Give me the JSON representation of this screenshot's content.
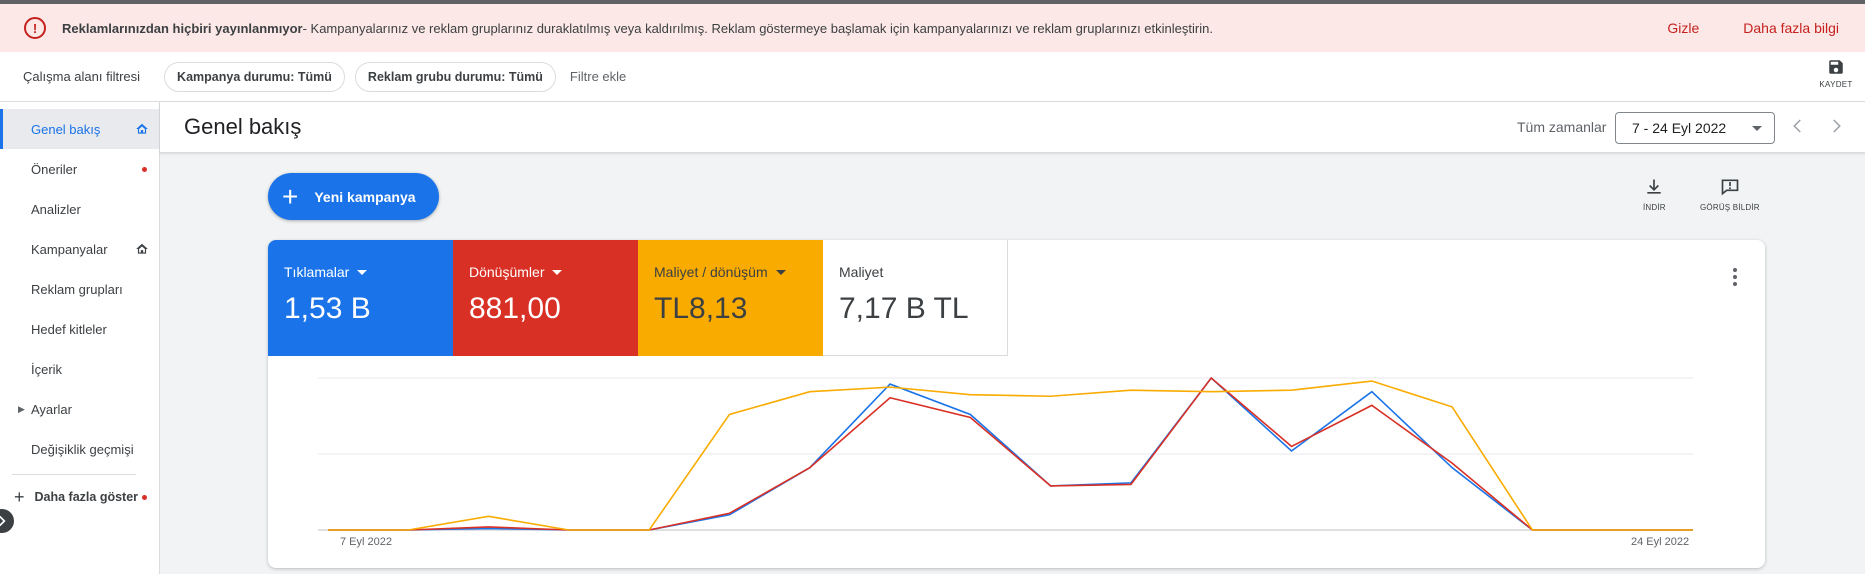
{
  "banner": {
    "title": "Reklamlarınızdan hiçbiri yayınlanmıyor",
    "message": " - Kampanyalarınız ve reklam gruplarınız duraklatılmış veya kaldırılmış. Reklam göstermeye başlamak için kampanyalarınızı ve reklam gruplarınızı etkinleştirin.",
    "hide_label": "Gizle",
    "more_info_label": "Daha fazla bilgi",
    "icon": "error-icon"
  },
  "filters": {
    "workspace_label": "Çalışma alanı filtresi",
    "chips": [
      "Kampanya durumu: Tümü",
      "Reklam grubu durumu: Tümü"
    ],
    "add_filter_placeholder": "Filtre ekle",
    "save_label": "KAYDET"
  },
  "sidebar": {
    "items": [
      {
        "label": "Genel bakış",
        "active": true,
        "icon": "home-icon"
      },
      {
        "label": "Öneriler",
        "dot": true
      },
      {
        "label": "Analizler"
      },
      {
        "label": "Kampanyalar",
        "icon": "home-icon"
      },
      {
        "label": "Reklam grupları"
      },
      {
        "label": "Hedef kitleler"
      },
      {
        "label": "İçerik"
      },
      {
        "label": "Ayarlar",
        "expandable": true
      },
      {
        "label": "Değişiklik geçmişi"
      }
    ],
    "more_label": "Daha fazla göster"
  },
  "header": {
    "title": "Genel bakış",
    "timeframe_label": "Tüm zamanlar",
    "date_range": "7 - 24 Eyl 2022"
  },
  "actions": {
    "new_campaign_label": "Yeni kampanya",
    "download_label": "İNDİR",
    "feedback_label": "GÖRÜŞ BİLDİR"
  },
  "metrics": [
    {
      "label": "Tıklamalar",
      "value": "1,53 B",
      "color": "#1a73e8",
      "dropdown": true
    },
    {
      "label": "Dönüşümler",
      "value": "881,00",
      "color": "#d93025",
      "dropdown": true
    },
    {
      "label": "Maliyet / dönüşüm",
      "value": "TL8,13",
      "color": "#f9ab00",
      "dropdown": true
    },
    {
      "label": "Maliyet",
      "value": "7,17 B TL",
      "color": "#ffffff",
      "dropdown": false
    }
  ],
  "chart_data": {
    "type": "line",
    "x": [
      "7 Eyl 2022",
      "8 Eyl 2022",
      "9 Eyl 2022",
      "10 Eyl 2022",
      "11 Eyl 2022",
      "12 Eyl 2022",
      "13 Eyl 2022",
      "14 Eyl 2022",
      "15 Eyl 2022",
      "16 Eyl 2022",
      "17 Eyl 2022",
      "18 Eyl 2022",
      "19 Eyl 2022",
      "20 Eyl 2022",
      "21 Eyl 2022",
      "22 Eyl 2022",
      "23 Eyl 2022",
      "24 Eyl 2022"
    ],
    "x_tick_labels": [
      "7 Eyl 2022",
      "24 Eyl 2022"
    ],
    "ylim": [
      0,
      1
    ],
    "series": [
      {
        "color": "#1a73e8",
        "values": [
          0,
          0,
          0.01,
          0,
          0,
          0.1,
          0.41,
          0.96,
          0.76,
          0.29,
          0.31,
          1.0,
          0.52,
          0.91,
          0.41,
          0,
          0,
          0
        ]
      },
      {
        "color": "#d93025",
        "values": [
          0,
          0,
          0.02,
          0,
          0,
          0.11,
          0.41,
          0.87,
          0.74,
          0.29,
          0.3,
          1.0,
          0.55,
          0.82,
          0.44,
          0,
          0,
          0
        ]
      },
      {
        "color": "#f9ab00",
        "values": [
          0,
          0,
          0.09,
          0,
          0,
          0.76,
          0.91,
          0.94,
          0.89,
          0.88,
          0.92,
          0.91,
          0.92,
          0.98,
          0.81,
          0,
          0,
          0
        ]
      }
    ],
    "grid": true
  }
}
